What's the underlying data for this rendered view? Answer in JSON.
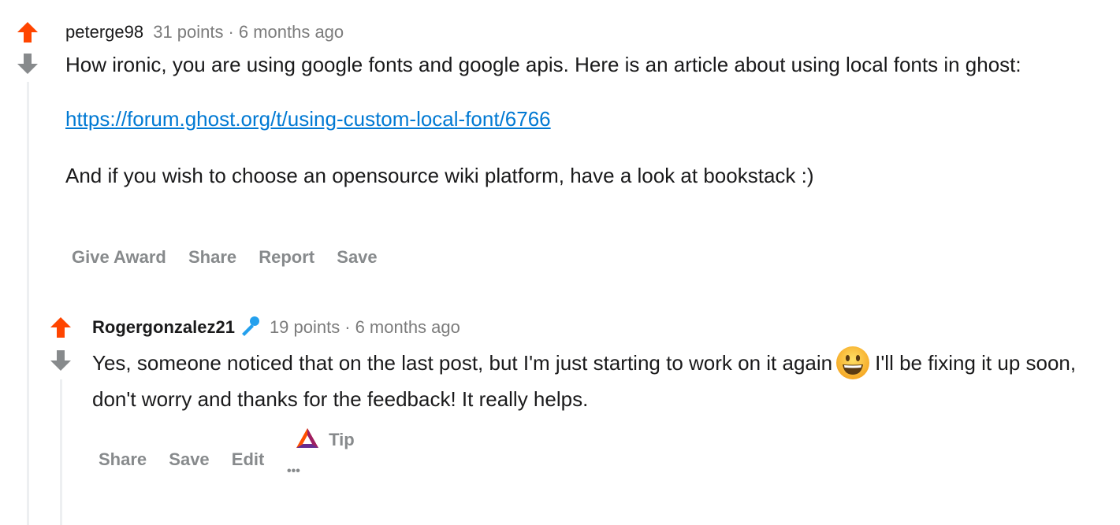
{
  "comment1": {
    "author": "peterge98",
    "points": "31 points",
    "separator": "·",
    "time": "6 months ago",
    "body_line1": "How ironic, you are using google fonts and google apis. Here is an article about using local fonts in ghost:",
    "link": "https://forum.ghost.org/t/using-custom-local-font/6766",
    "body_line2": "And if you wish to choose an opensource wiki platform, have a look at bookstack :)",
    "actions": {
      "give_award": "Give Award",
      "share": "Share",
      "report": "Report",
      "save": "Save"
    }
  },
  "comment2": {
    "author": "Rogergonzalez21",
    "author_icon": "microphone-icon",
    "points": "19 points",
    "separator": "·",
    "time": "6 months ago",
    "body_part1": "Yes, someone noticed that on the last post, but I'm just starting to work on it again",
    "emoji": "grinning-face-icon",
    "body_part2": "I'll be fixing it up soon, don't worry and thanks for the feedback! It really helps.",
    "actions": {
      "share": "Share",
      "save": "Save",
      "edit": "Edit",
      "tip": "Tip",
      "more": "•••"
    }
  },
  "colors": {
    "upvote": "#ff4500",
    "downvote": "#878a8c",
    "link": "#0079d3",
    "meta": "#7c7c7c",
    "action": "#878a8c",
    "mic": "#24a0ed"
  }
}
